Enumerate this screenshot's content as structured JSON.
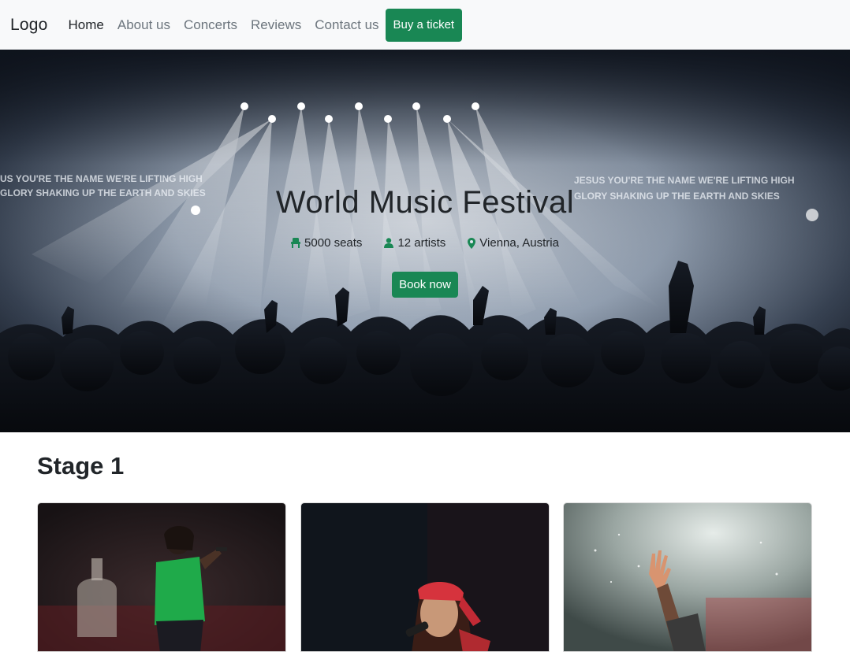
{
  "navbar": {
    "brand": "Logo",
    "links": [
      {
        "label": "Home",
        "active": true
      },
      {
        "label": "About us",
        "active": false
      },
      {
        "label": "Concerts",
        "active": false
      },
      {
        "label": "Reviews",
        "active": false
      },
      {
        "label": "Contact us",
        "active": false
      }
    ],
    "cta_label": "Buy a ticket"
  },
  "hero": {
    "title": "World Music Festival",
    "meta": [
      {
        "icon": "seat-icon",
        "text": "5000 seats"
      },
      {
        "icon": "person-icon",
        "text": "12 artists"
      },
      {
        "icon": "map-pin-icon",
        "text": "Vienna, Austria"
      }
    ],
    "book_label": "Book now",
    "screen_text_left": [
      "US YOU'RE THE NAME WE'RE LIFTING HIGH",
      "GLORY SHAKING UP THE EARTH AND SKIES"
    ],
    "screen_text_right": [
      "JESUS YOU'RE THE NAME WE'RE LIFTING HIGH",
      "GLORY SHAKING UP THE EARTH AND SKIES"
    ]
  },
  "stage": {
    "title": "Stage 1"
  },
  "colors": {
    "accent": "#198754",
    "navbar_bg": "#f8f9fa",
    "muted_link": "#6c757d",
    "icon_green": "#198754"
  }
}
